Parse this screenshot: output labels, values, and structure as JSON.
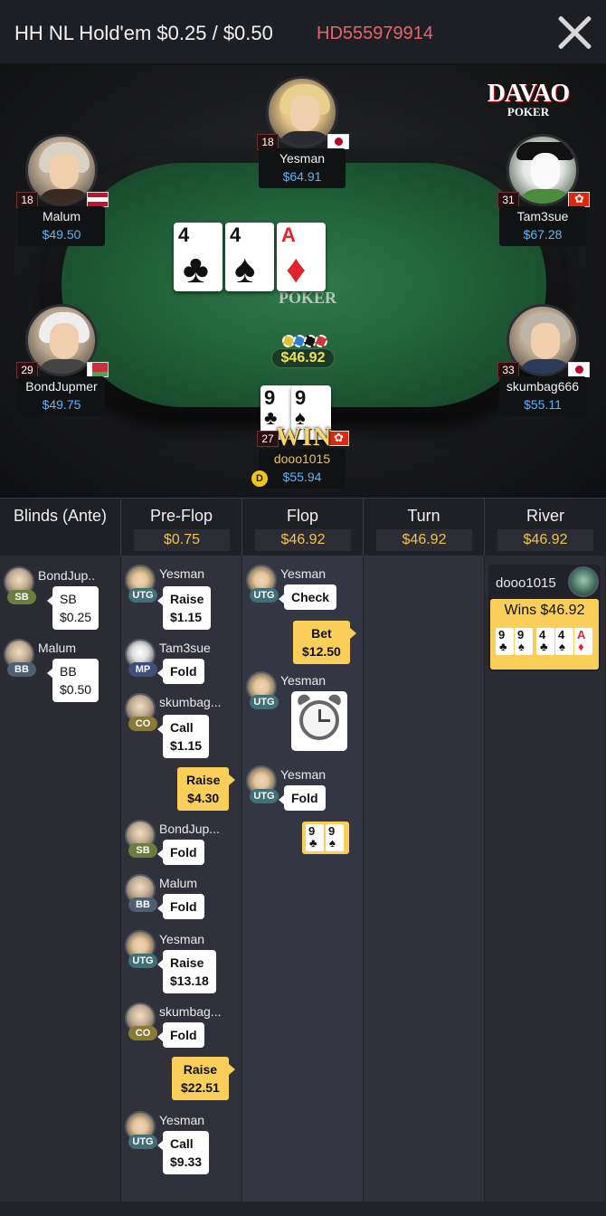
{
  "header": {
    "title": "HH NL Hold'em $0.25 / $0.50",
    "hand_id": "HD555979914",
    "close_icon": "close-icon"
  },
  "branding": {
    "logo_big": "DAVAO",
    "logo_small": "POKER"
  },
  "table": {
    "felt_logo_small": "POKER",
    "pot": "$46.92",
    "board": [
      {
        "rank": "4",
        "suit": "♣",
        "color": "black"
      },
      {
        "rank": "4",
        "suit": "♠",
        "color": "black"
      },
      {
        "rank": "A",
        "suit": "♦",
        "color": "red"
      }
    ],
    "hero_cards": [
      {
        "rank": "9",
        "suit": "♣",
        "color": "black"
      },
      {
        "rank": "9",
        "suit": "♠",
        "color": "black"
      }
    ],
    "win_label": "WIN",
    "dealer_label": "D",
    "players": [
      {
        "name": "Yesman",
        "stack": "$64.91",
        "level": "18",
        "flag": "jp"
      },
      {
        "name": "Malum",
        "stack": "$49.50",
        "level": "18",
        "flag": "at"
      },
      {
        "name": "Tam3sue",
        "stack": "$67.28",
        "level": "31",
        "flag": "hk"
      },
      {
        "name": "BondJupmer",
        "stack": "$49.75",
        "level": "29",
        "flag": "by"
      },
      {
        "name": "skumbag666",
        "stack": "$55.11",
        "level": "33",
        "flag": "jp"
      },
      {
        "name": "dooo1015",
        "stack": "$55.94",
        "level": "27",
        "flag": "hk"
      }
    ]
  },
  "streets": [
    {
      "name": "Blinds (Ante)",
      "amount": ""
    },
    {
      "name": "Pre-Flop",
      "amount": "$0.75"
    },
    {
      "name": "Flop",
      "amount": "$46.92"
    },
    {
      "name": "Turn",
      "amount": "$46.92"
    },
    {
      "name": "River",
      "amount": "$46.92"
    }
  ],
  "log": {
    "blinds": [
      {
        "name": "BondJup..",
        "pos": "SB",
        "action": "SB",
        "amount": "$0.25"
      },
      {
        "name": "Malum",
        "pos": "BB",
        "action": "BB",
        "amount": "$0.50"
      }
    ],
    "preflop": [
      {
        "name": "Yesman",
        "pos": "UTG",
        "action": "Raise",
        "amount": "$1.15"
      },
      {
        "name": "Tam3sue",
        "pos": "MP",
        "action": "Fold",
        "amount": ""
      },
      {
        "name": "skumbag...",
        "pos": "CO",
        "action": "Call",
        "amount": "$1.15"
      },
      {
        "hero": true,
        "action": "Raise",
        "amount": "$4.30"
      },
      {
        "name": "BondJup...",
        "pos": "SB",
        "action": "Fold",
        "amount": ""
      },
      {
        "name": "Malum",
        "pos": "BB",
        "action": "Fold",
        "amount": ""
      },
      {
        "name": "Yesman",
        "pos": "UTG",
        "action": "Raise",
        "amount": "$13.18"
      },
      {
        "name": "skumbag...",
        "pos": "CO",
        "action": "Fold",
        "amount": ""
      },
      {
        "hero": true,
        "action": "Raise",
        "amount": "$22.51"
      },
      {
        "name": "Yesman",
        "pos": "UTG",
        "action": "Call",
        "amount": "$9.33"
      }
    ],
    "flop": [
      {
        "name": "Yesman",
        "pos": "UTG",
        "action": "Check",
        "amount": ""
      },
      {
        "hero": true,
        "action": "Bet",
        "amount": "$12.50"
      },
      {
        "name": "Yesman",
        "pos": "UTG",
        "action": "timeout",
        "icon": "alarm-clock-icon"
      },
      {
        "name": "Yesman",
        "pos": "UTG",
        "action": "Fold",
        "amount": ""
      },
      {
        "hero": true,
        "action": "show",
        "cards": [
          {
            "rank": "9",
            "suit": "♣",
            "color": "black"
          },
          {
            "rank": "9",
            "suit": "♠",
            "color": "black"
          }
        ]
      }
    ],
    "river": {
      "winner": "dooo1015",
      "wins_text": "Wins $46.92",
      "cards": [
        {
          "rank": "9",
          "suit": "♣",
          "color": "black"
        },
        {
          "rank": "9",
          "suit": "♠",
          "color": "black"
        },
        {
          "rank": "4",
          "suit": "♣",
          "color": "black"
        },
        {
          "rank": "4",
          "suit": "♠",
          "color": "black"
        },
        {
          "rank": "A",
          "suit": "♦",
          "color": "red"
        }
      ]
    }
  },
  "colors": {
    "accent_gold": "#f9cf5a",
    "stack_blue": "#58b5ff",
    "hand_id_red": "#e8646c",
    "pot_yellow": "#f3e34a"
  }
}
